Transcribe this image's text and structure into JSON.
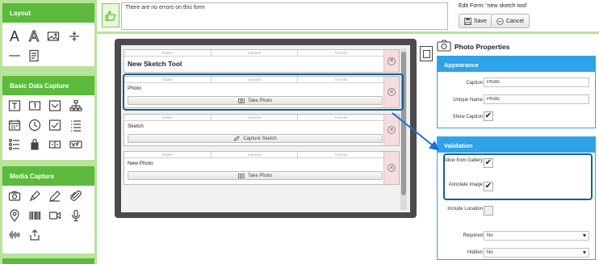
{
  "sidebar": {
    "panels": [
      {
        "title": "Layout",
        "tools": [
          "text-large-icon",
          "text-outline-icon",
          "image-icon",
          "divider-icon",
          "spacer-icon",
          "page-icon"
        ]
      },
      {
        "title": "Basic Data Capture",
        "tools": [
          "text-field-icon",
          "number-field-icon",
          "dropdown-icon",
          "hierarchy-icon",
          "date-icon",
          "time-icon",
          "checkbox-icon",
          "list-icon",
          "radio-list-icon",
          "barcode-lock-icon",
          "slider-icon",
          "yes-no-icon"
        ]
      },
      {
        "title": "Media Capture",
        "tools": [
          "camera-icon",
          "sketch-icon",
          "pen-icon",
          "attachment-icon",
          "location-icon",
          "barcode-icon",
          "video-icon",
          "microphone-icon",
          "audio-wave-icon",
          "export-icon"
        ]
      }
    ]
  },
  "topbar": {
    "message": "There are no errors on this form",
    "edit_title": "Edit Form: 'new sketch tool'",
    "save_label": "Save",
    "cancel_label": "Cancel"
  },
  "canvas": {
    "flag_labels": [
      "hidden",
      "required",
      "formula"
    ],
    "fields": [
      {
        "label": "New Sketch Tool",
        "button": ""
      },
      {
        "label": "Photo",
        "button": "Take Photo"
      },
      {
        "label": "Sketch",
        "button": "Capture Sketch"
      },
      {
        "label": "New Photo",
        "button": "Take Photo"
      }
    ]
  },
  "properties": {
    "title": "Photo Properties",
    "appearance": {
      "heading": "Appearance",
      "caption_label": "Caption",
      "caption_value": "Photo",
      "unique_name_label": "Unique Name",
      "unique_name_value": "Photo",
      "show_caption_label": "Show Caption",
      "show_caption_checked": true
    },
    "validation": {
      "heading": "Validation",
      "allow_gallery_label": "Allow from Gallery",
      "allow_gallery_checked": true,
      "annotate_label": "Annotate Image",
      "annotate_checked": true,
      "include_location_label": "Include Location",
      "include_location_checked": false,
      "required_label": "Required",
      "required_value": "No",
      "hidden_label": "Hidden",
      "hidden_value": "No"
    }
  },
  "colors": {
    "sidebar_bg": "#b8e39a",
    "panel_header": "#5cba3c",
    "section_header": "#2ea3e8",
    "highlight": "#1b5e8c",
    "delete_bg": "#f6dede"
  }
}
